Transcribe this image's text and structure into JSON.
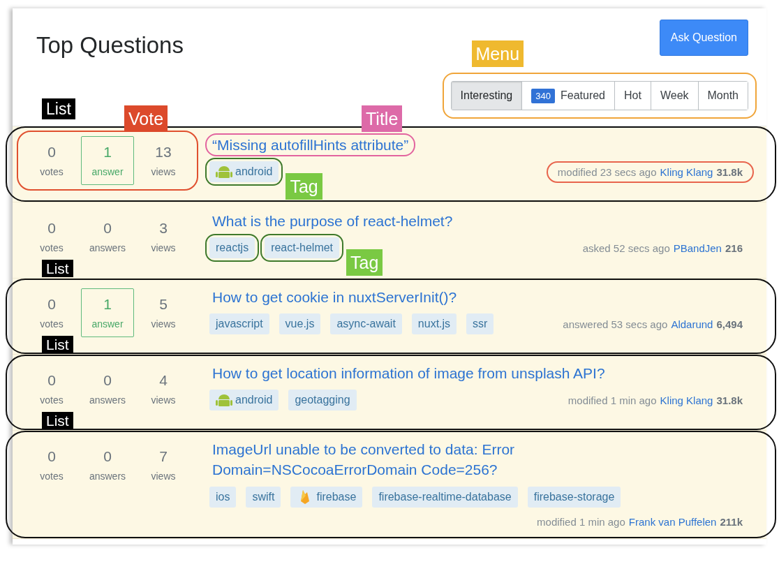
{
  "title": "Top Questions",
  "ask_button": "Ask Question",
  "menu": {
    "callout": "Menu",
    "outlined": true,
    "tabs": [
      {
        "label": "Interesting",
        "selected": true
      },
      {
        "label": "Featured",
        "badge": "340",
        "selected": false
      },
      {
        "label": "Hot",
        "selected": false
      },
      {
        "label": "Week",
        "selected": false
      },
      {
        "label": "Month",
        "selected": false
      }
    ]
  },
  "questions": [
    {
      "list_label": "List",
      "outlined": true,
      "stats_outlined": true,
      "votes": "0",
      "votes_label": "votes",
      "answers": "1",
      "answers_label": "answer",
      "answered": true,
      "views": "13",
      "views_label": "views",
      "title": "“Missing autofillHints attribute”",
      "title_outlined": true,
      "tags": [
        {
          "name": "android",
          "kind": "platform",
          "outlined": true
        }
      ],
      "action": "modified 23 secs ago",
      "user": "Kling Klang",
      "rep": "31.8k",
      "meta_outlined": true,
      "vote_callout": "Vote",
      "title_callout": "Title",
      "tag_callout": "Tag"
    },
    {
      "outlined": false,
      "stats_outlined": false,
      "votes": "0",
      "votes_label": "votes",
      "answers": "0",
      "answers_label": "answers",
      "answered": false,
      "views": "3",
      "views_label": "views",
      "title": "What is the purpose of react-helmet?",
      "title_outlined": false,
      "tags": [
        {
          "name": "reactjs",
          "kind": "plain",
          "outlined": true
        },
        {
          "name": "react-helmet",
          "kind": "plain",
          "outlined": true
        }
      ],
      "action": "asked 52 secs ago",
      "user": "PBandJen",
      "rep": "216",
      "meta_outlined": false,
      "tag_callout": "Tag"
    },
    {
      "list_label": "List",
      "outlined": true,
      "stats_outlined": false,
      "votes": "0",
      "votes_label": "votes",
      "answers": "1",
      "answers_label": "answer",
      "answered": true,
      "views": "5",
      "views_label": "views",
      "title": "How to get cookie in nuxtServerInit()?",
      "title_outlined": false,
      "tags": [
        {
          "name": "javascript",
          "kind": "plain",
          "outlined": false
        },
        {
          "name": "vue.js",
          "kind": "plain",
          "outlined": false
        },
        {
          "name": "async-await",
          "kind": "plain",
          "outlined": false
        },
        {
          "name": "nuxt.js",
          "kind": "plain",
          "outlined": false
        },
        {
          "name": "ssr",
          "kind": "plain",
          "outlined": false
        }
      ],
      "action": "answered 53 secs ago",
      "user": "Aldarund",
      "rep": "6,494",
      "meta_outlined": false
    },
    {
      "list_label": "List",
      "outlined": true,
      "stats_outlined": false,
      "votes": "0",
      "votes_label": "votes",
      "answers": "0",
      "answers_label": "answers",
      "answered": false,
      "views": "4",
      "views_label": "views",
      "title": "How to get location information of image from unsplash API?",
      "title_outlined": false,
      "tags": [
        {
          "name": "android",
          "kind": "platform",
          "outlined": false
        },
        {
          "name": "geotagging",
          "kind": "plain",
          "outlined": false
        }
      ],
      "action": "modified 1 min ago",
      "user": "Kling Klang",
      "rep": "31.8k",
      "meta_outlined": false
    },
    {
      "list_label": "List",
      "outlined": true,
      "stats_outlined": false,
      "votes": "0",
      "votes_label": "votes",
      "answers": "0",
      "answers_label": "answers",
      "answered": false,
      "views": "7",
      "views_label": "views",
      "title": "ImageUrl unable to be converted to data: Error Domain=NSCocoaErrorDomain Code=256?",
      "title_outlined": false,
      "tags": [
        {
          "name": "ios",
          "kind": "plain",
          "outlined": false
        },
        {
          "name": "swift",
          "kind": "plain",
          "outlined": false
        },
        {
          "name": "firebase",
          "kind": "service",
          "outlined": false
        },
        {
          "name": "firebase-realtime-database",
          "kind": "plain",
          "outlined": false
        },
        {
          "name": "firebase-storage",
          "kind": "plain",
          "outlined": false
        }
      ],
      "action": "modified 1 min ago",
      "user": "Frank van Puffelen",
      "rep": "211k",
      "meta_outlined": false
    }
  ]
}
